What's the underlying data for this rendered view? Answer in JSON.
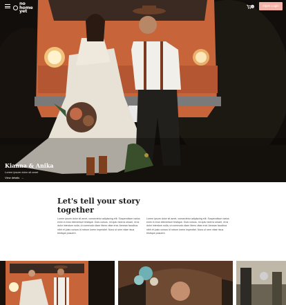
{
  "header": {
    "logo_text": "no home yet",
    "logo_line1": "no",
    "logo_line2": "home",
    "logo_line3": "yet",
    "cart_count": "0",
    "cta_label": "Open Login"
  },
  "hero": {
    "title": "Kianna & Anika",
    "subtitle": "Lorem ipsum dolor sit amet",
    "link_label": "View details",
    "link_arrow": "→"
  },
  "story": {
    "title": "Let's tell your story together",
    "col1": "Lorem ipsum dolor sit amet, consectetur adipiscing elit. Suspendisse varius enim in eros elementum tristique. Duis cursus, mi quis viverra ornare, eros dolor interdum nulla, ut commodo diam libero vitae erat. Aenean faucibus nibh et justo cursus id rutrum lorem imperdiet. Nunc ut sem vitae risus tristique posuere.",
    "col2": "Lorem ipsum dolor sit amet, consectetur adipiscing elit. Suspendisse varius enim in eros elementum tristique. Duis cursus, mi quis viverra ornare, eros dolor interdum nulla, ut commodo diam libero vitae erat. Aenean faucibus nibh et justo cursus id rutrum lorem imperdiet. Nunc ut sem vitae risus tristique posuere."
  },
  "colors": {
    "accent": "#f3b3a8",
    "van": "#c8643a",
    "dark": "#0c0a08"
  },
  "icons": {
    "menu": "menu-icon",
    "cart": "cart-icon",
    "arrow": "arrow-right-icon"
  }
}
